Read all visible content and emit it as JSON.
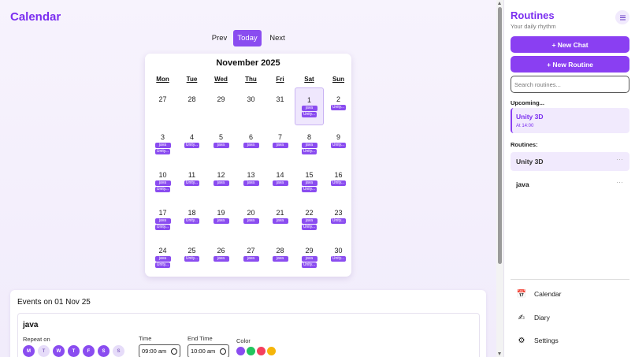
{
  "main": {
    "title": "Calendar",
    "nav": {
      "prev": "Prev",
      "today": "Today",
      "next": "Next"
    },
    "calendar": {
      "month_label": "November 2025",
      "weekdays": [
        "Mon",
        "Tue",
        "Wed",
        "Thu",
        "Fri",
        "Sat",
        "Sun"
      ],
      "weeks": [
        [
          {
            "day": "27",
            "events": []
          },
          {
            "day": "28",
            "events": []
          },
          {
            "day": "29",
            "events": []
          },
          {
            "day": "30",
            "events": []
          },
          {
            "day": "31",
            "events": []
          },
          {
            "day": "1",
            "events": [
              "java",
              "Unity..."
            ],
            "selected": true
          },
          {
            "day": "2",
            "events": [
              "Unity..."
            ]
          }
        ],
        [
          {
            "day": "3",
            "events": [
              "java",
              "Unity..."
            ]
          },
          {
            "day": "4",
            "events": [
              "Unity..."
            ]
          },
          {
            "day": "5",
            "events": [
              "java"
            ]
          },
          {
            "day": "6",
            "events": [
              "java"
            ]
          },
          {
            "day": "7",
            "events": [
              "java"
            ]
          },
          {
            "day": "8",
            "events": [
              "java",
              "Unity..."
            ]
          },
          {
            "day": "9",
            "events": [
              "Unity..."
            ]
          }
        ],
        [
          {
            "day": "10",
            "events": [
              "java",
              "Unity..."
            ]
          },
          {
            "day": "11",
            "events": [
              "Unity..."
            ]
          },
          {
            "day": "12",
            "events": [
              "java"
            ]
          },
          {
            "day": "13",
            "events": [
              "java"
            ]
          },
          {
            "day": "14",
            "events": [
              "java"
            ]
          },
          {
            "day": "15",
            "events": [
              "java",
              "Unity..."
            ]
          },
          {
            "day": "16",
            "events": [
              "Unity..."
            ]
          }
        ],
        [
          {
            "day": "17",
            "events": [
              "java",
              "Unity..."
            ]
          },
          {
            "day": "18",
            "events": [
              "Unity..."
            ]
          },
          {
            "day": "19",
            "events": [
              "java"
            ]
          },
          {
            "day": "20",
            "events": [
              "java"
            ]
          },
          {
            "day": "21",
            "events": [
              "java"
            ]
          },
          {
            "day": "22",
            "events": [
              "java",
              "Unity..."
            ]
          },
          {
            "day": "23",
            "events": [
              "Unity..."
            ]
          }
        ],
        [
          {
            "day": "24",
            "events": [
              "java",
              "Unity..."
            ]
          },
          {
            "day": "25",
            "events": [
              "Unity..."
            ]
          },
          {
            "day": "26",
            "events": [
              "java"
            ]
          },
          {
            "day": "27",
            "events": [
              "java"
            ]
          },
          {
            "day": "28",
            "events": [
              "java"
            ]
          },
          {
            "day": "29",
            "events": [
              "java",
              "Unity..."
            ]
          },
          {
            "day": "30",
            "events": [
              "Unity..."
            ]
          }
        ]
      ]
    },
    "events": {
      "heading": "Events on 01 Nov 25",
      "item": {
        "name": "java",
        "repeat_label": "Repeat on",
        "days": [
          {
            "letter": "M",
            "on": true
          },
          {
            "letter": "T",
            "on": false
          },
          {
            "letter": "W",
            "on": true
          },
          {
            "letter": "T",
            "on": true
          },
          {
            "letter": "F",
            "on": true
          },
          {
            "letter": "S",
            "on": true
          },
          {
            "letter": "S",
            "on": false
          }
        ],
        "time_label": "Time",
        "time_value": "09:00 am",
        "end_time_label": "End Time",
        "end_time_value": "10:00 am",
        "color_label": "Color",
        "colors": [
          "#8a4cf0",
          "#22c55e",
          "#f43f5e",
          "#f5b50a"
        ]
      }
    }
  },
  "sidebar": {
    "title": "Routines",
    "subtitle": "Your daily rhythm",
    "menu_icon": "hamburger-icon",
    "new_chat": "+ New Chat",
    "new_routine": "+ New Routine",
    "search_placeholder": "Search routines...",
    "upcoming_label": "Upcoming...",
    "upcoming": {
      "name": "Unity 3D",
      "time": "At 14:00"
    },
    "routines_label": "Routines:",
    "routines": [
      {
        "name": "Unity 3D",
        "active": true
      },
      {
        "name": "java",
        "active": false
      }
    ],
    "more_icon": "···",
    "links": [
      {
        "label": "Calendar",
        "icon": "calendar-icon",
        "glyph": "📅"
      },
      {
        "label": "Diary",
        "icon": "pencil-icon",
        "glyph": "✍"
      },
      {
        "label": "Settings",
        "icon": "gear-icon",
        "glyph": "⚙"
      }
    ]
  },
  "colors": {
    "accent": "#8a3ff2",
    "accent_light": "#f1eafd",
    "title": "#7b2ff0"
  }
}
